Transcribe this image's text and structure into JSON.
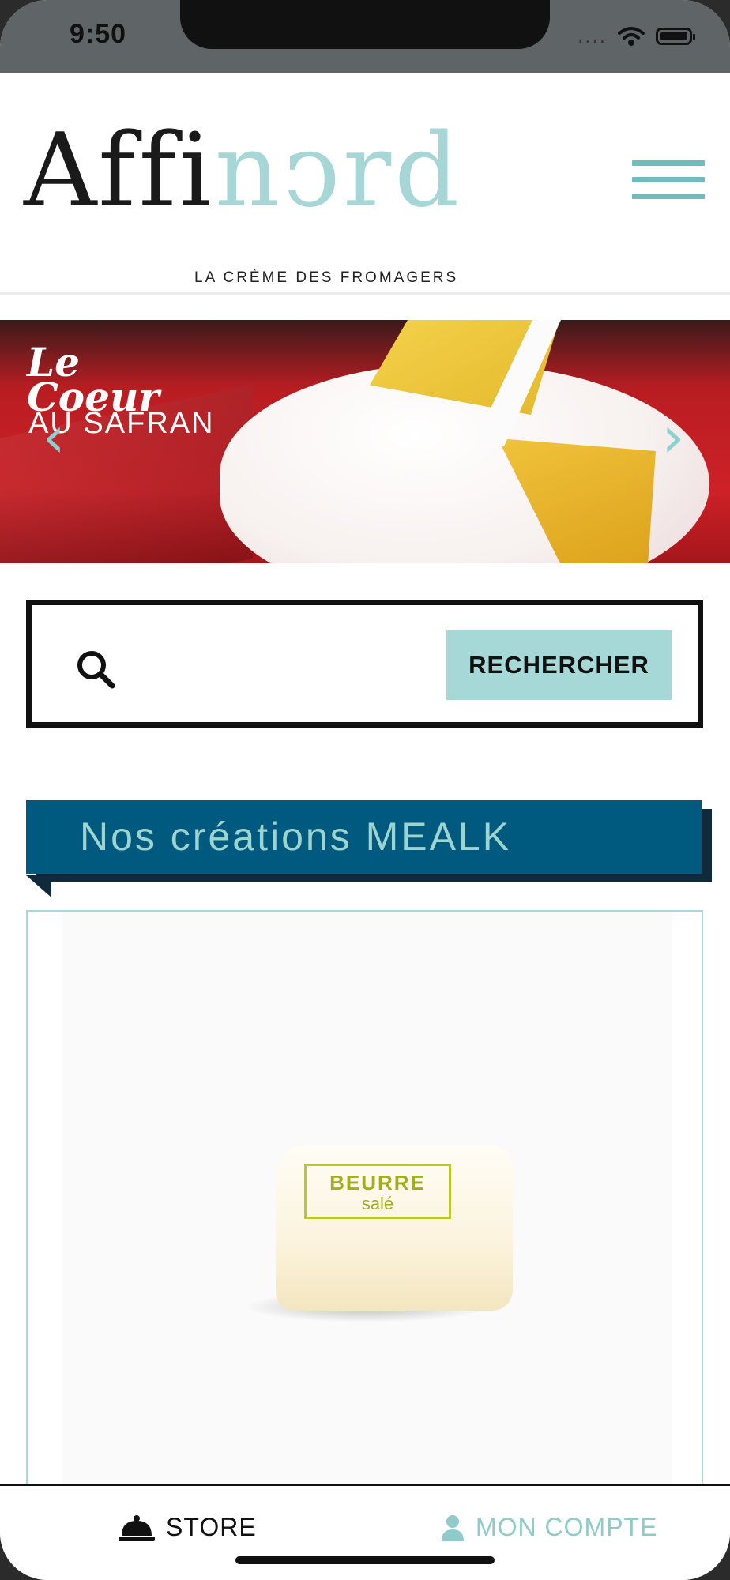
{
  "status_bar": {
    "time": "9:50",
    "signal": "....",
    "wifi_icon": "wifi-icon",
    "battery_icon": "battery-icon"
  },
  "header": {
    "logo_part1": "Affi",
    "logo_part2": "nↄrd",
    "tagline": "LA CRÈME DES FROMAGERS",
    "menu_icon": "hamburger-menu-icon"
  },
  "banner": {
    "title_line1": "Le",
    "title_line2": "Coeur",
    "title_line3": "AU SAFRAN",
    "prev_icon": "‹",
    "next_icon": "›"
  },
  "search": {
    "placeholder": "",
    "value": "",
    "button_label": "RECHERCHER"
  },
  "section": {
    "title": "Nos créations MEALK"
  },
  "product": {
    "label_main": "BEURRE",
    "label_sub": "salé"
  },
  "tab_bar": {
    "store_label": "STORE",
    "account_label": "MON COMPTE"
  },
  "colors": {
    "accent_teal": "#a5d8d6",
    "ribbon_blue": "#005a80",
    "logo_teal": "#a6d6d6"
  }
}
